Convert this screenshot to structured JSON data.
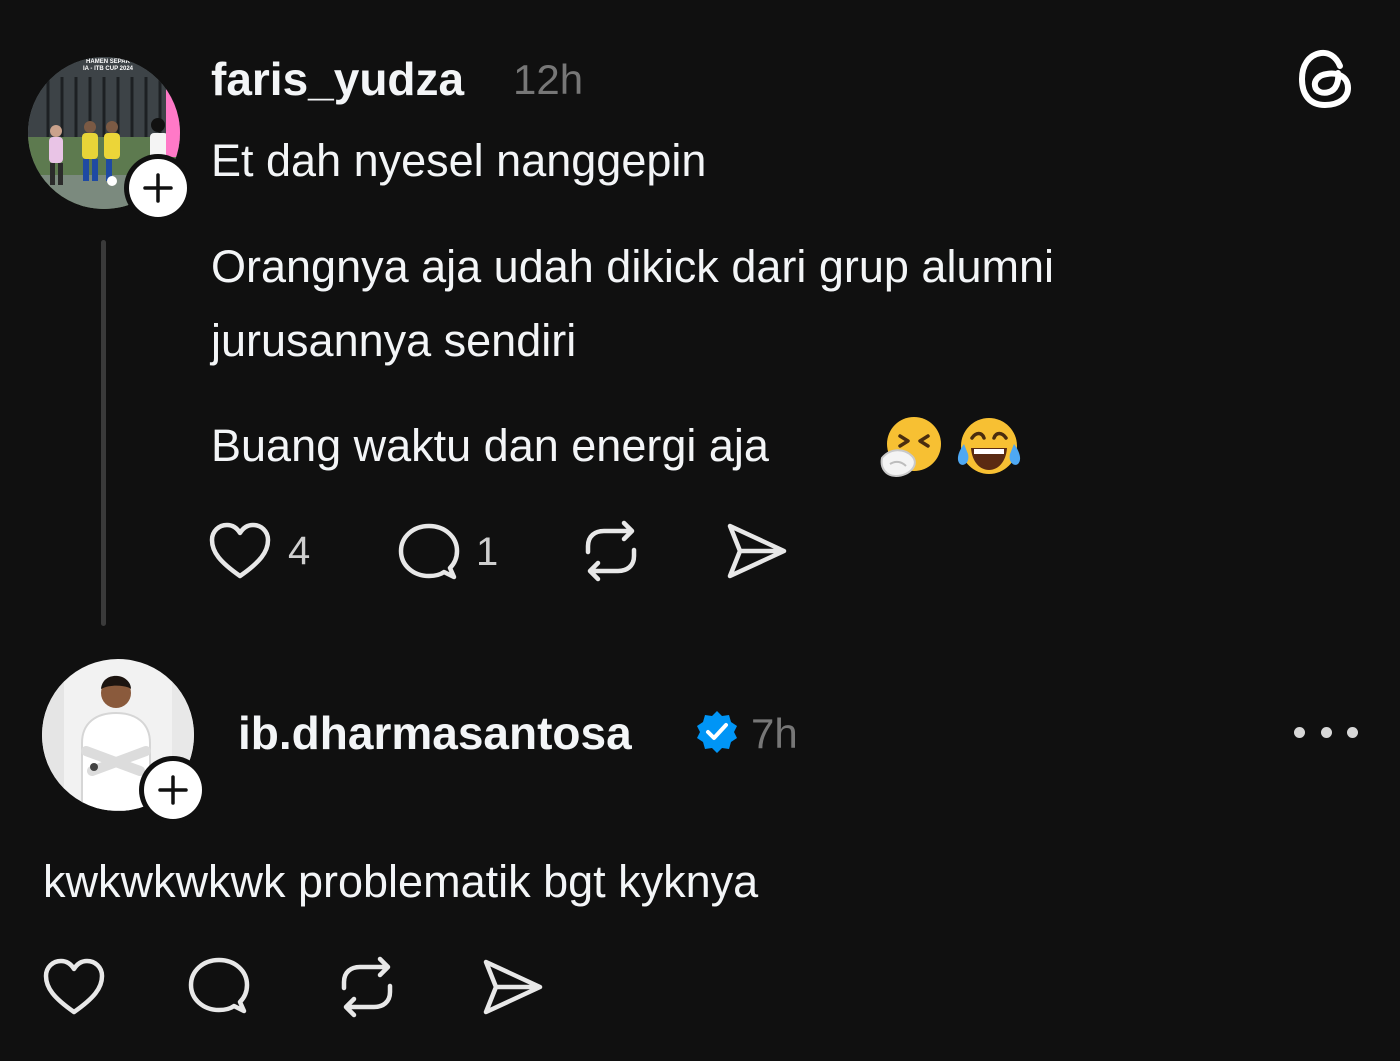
{
  "post": {
    "username": "faris_yudza",
    "time": "12h",
    "lines": [
      "Et dah nyesel nanggepin",
      "Orangnya aja udah dikick dari grup alumni",
      "jurusannya sendiri",
      "Buang waktu dan energi aja"
    ],
    "emojis": [
      "sneezing-face-emoji",
      "tears-of-joy-emoji"
    ],
    "avatar_banner": "HAMEN SEPAK\nIA - ITB CUP 2024",
    "likes": "4",
    "replies": "1"
  },
  "reply": {
    "username": "ib.dharmasantosa",
    "verified": true,
    "time": "7h",
    "text": "kwkwkwkwk problematik bgt kyknya"
  },
  "icons": {
    "app_logo": "threads-logo-icon",
    "like": "heart-icon",
    "comment": "speech-bubble-icon",
    "repost": "repost-icon",
    "share": "paper-plane-icon",
    "more": "more-horizontal-icon",
    "follow": "plus-icon",
    "verified": "verified-badge-icon"
  },
  "colors": {
    "background": "#101010",
    "text": "#f3f5f7",
    "muted": "#777777",
    "verified": "#0095f6"
  }
}
